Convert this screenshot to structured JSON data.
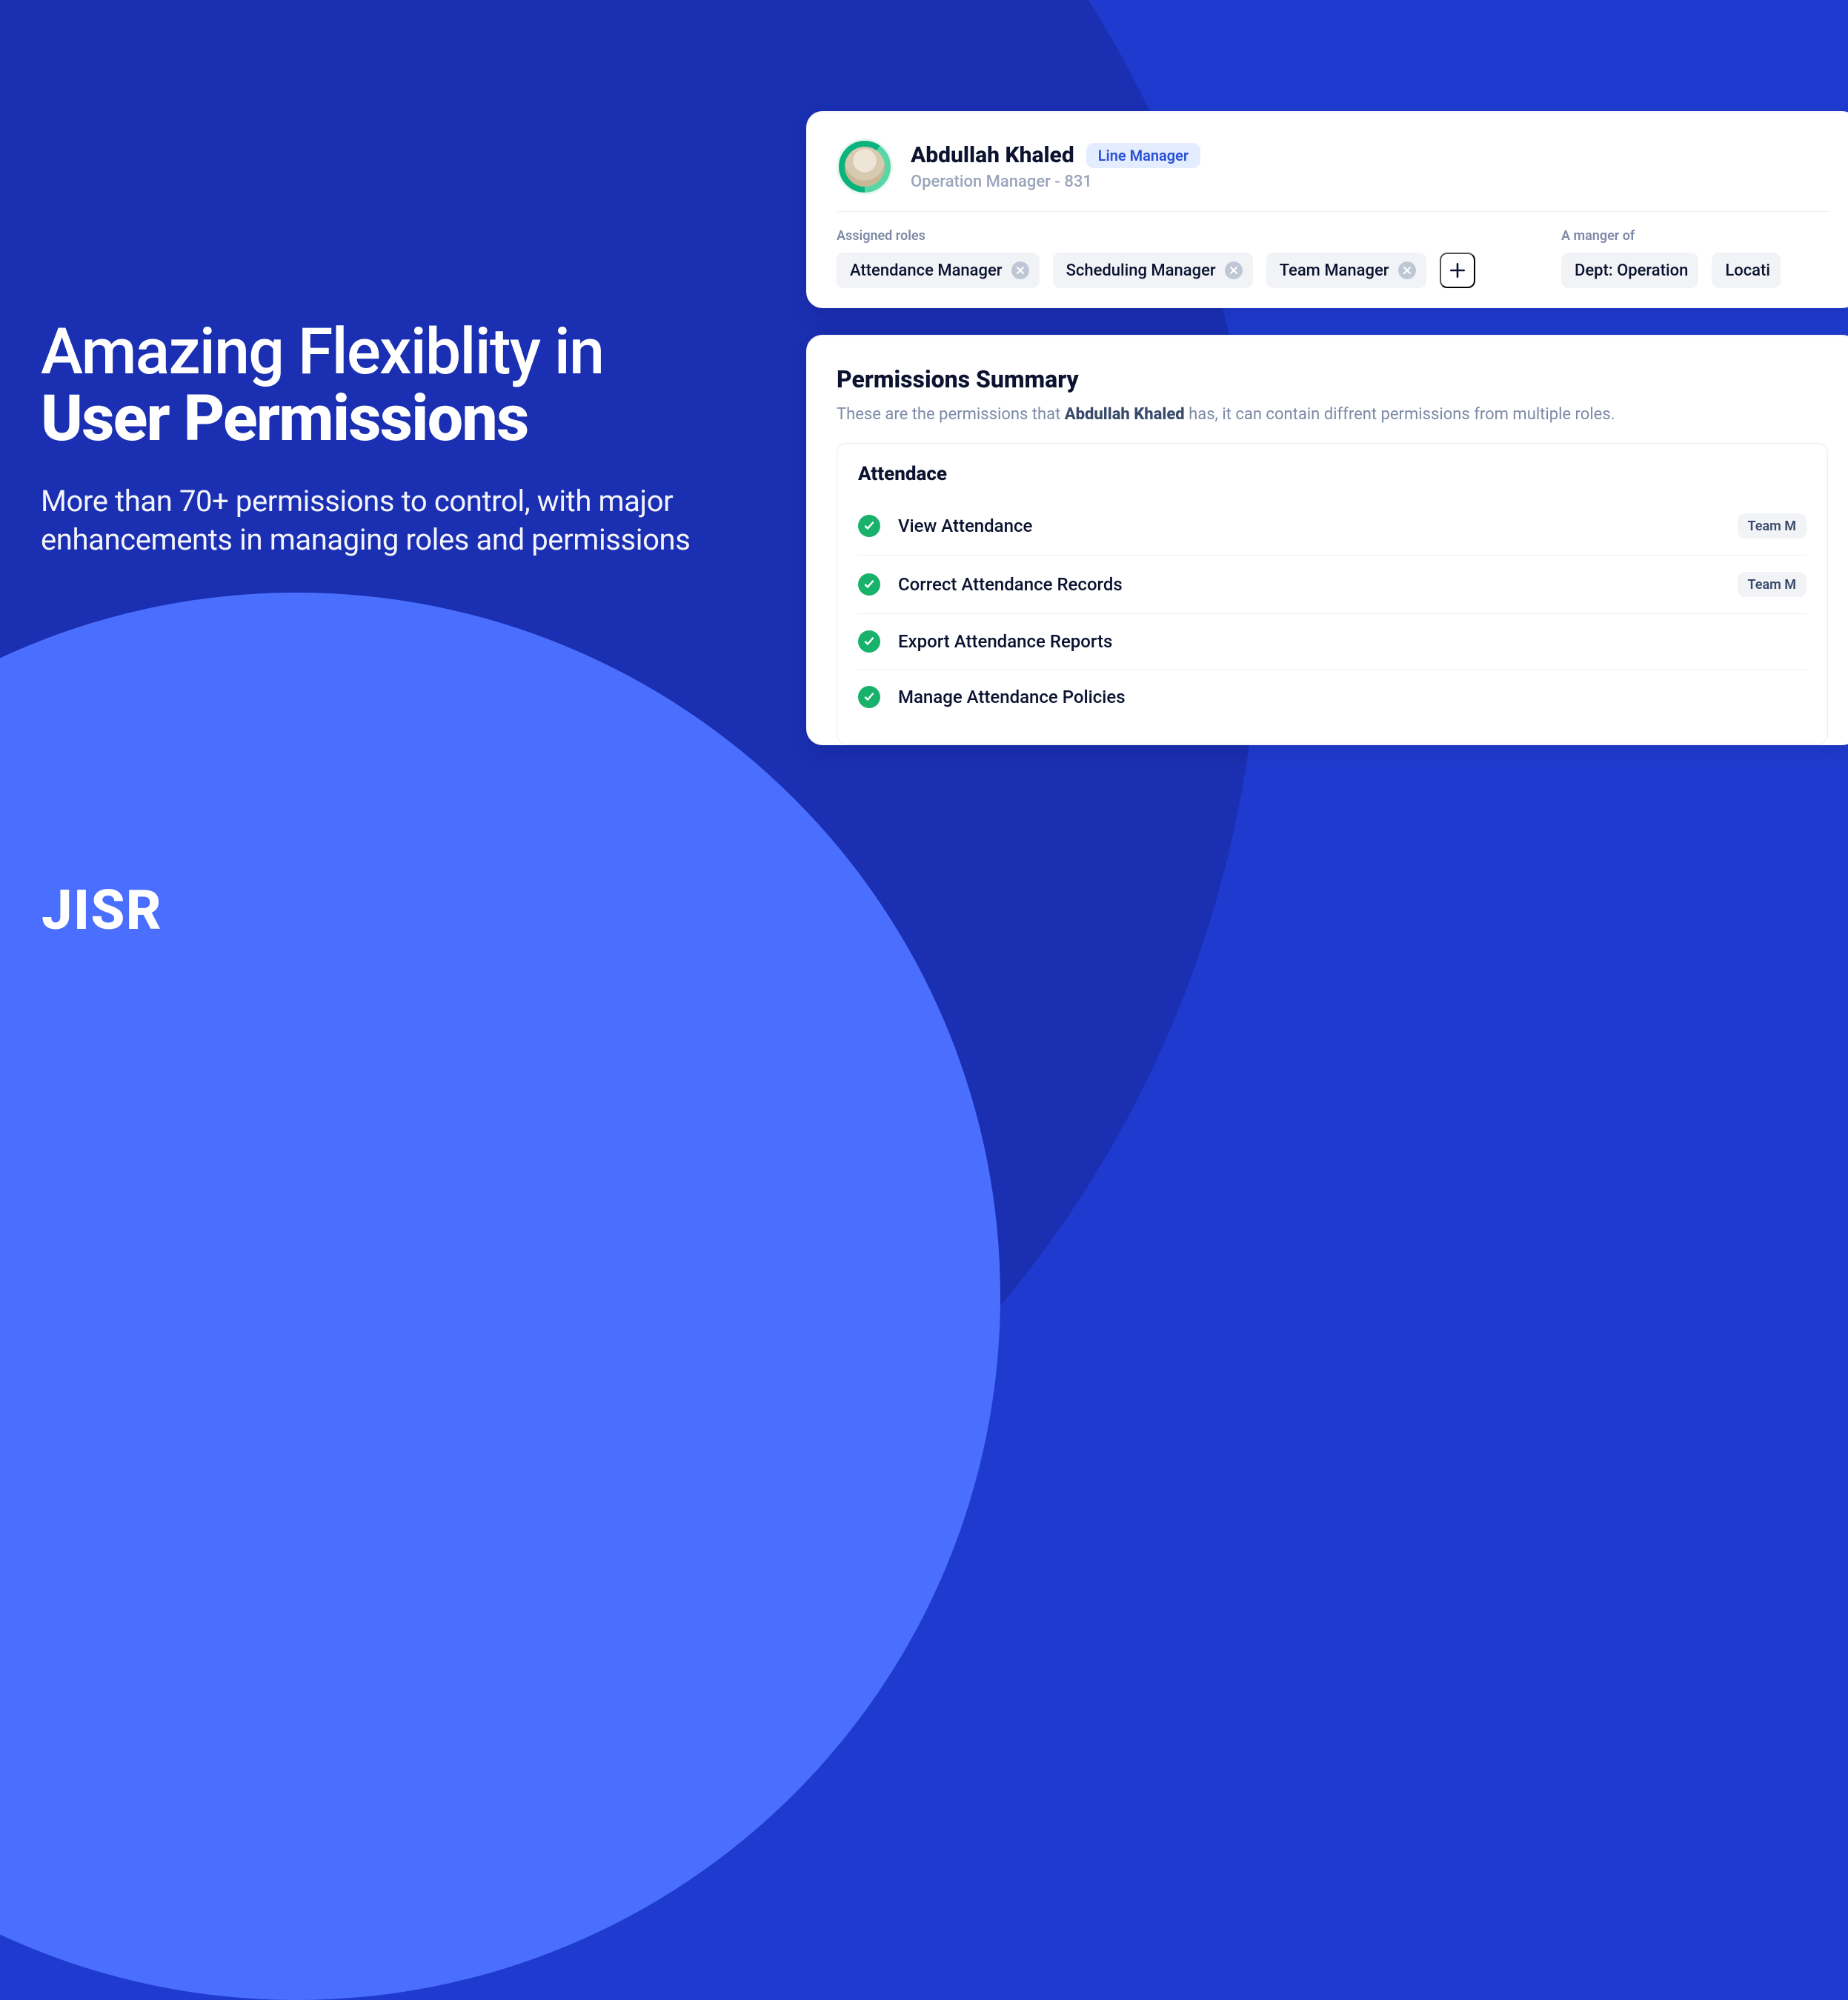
{
  "hero": {
    "title_line1": "Amazing Flexiblity in",
    "title_bold": "User Permissions",
    "subtitle": "More than 70+ permissions to control, with major enhancements in managing roles and permissions"
  },
  "brand": {
    "name": "JISR"
  },
  "user": {
    "name": "Abdullah Khaled",
    "badge": "Line Manager",
    "subtitle": "Operation Manager - 831"
  },
  "roles": {
    "label": "Assigned roles",
    "items": [
      {
        "label": "Attendance Manager"
      },
      {
        "label": "Scheduling Manager"
      },
      {
        "label": "Team Manager"
      }
    ]
  },
  "manager_of": {
    "label": "A manger of",
    "items": [
      {
        "label": "Dept: Operation"
      },
      {
        "label": "Locati"
      }
    ]
  },
  "permissions": {
    "title": "Permissions Summary",
    "desc_prefix": "These are the permissions that ",
    "desc_name": "Abdullah Khaled",
    "desc_suffix": " has, it can contain diffrent permissions from multiple roles.",
    "group_title": "Attendace",
    "items": [
      {
        "name": "View Attendance",
        "access": "Team M"
      },
      {
        "name": "Correct Attendance Records",
        "access": "Team M"
      },
      {
        "name": "Export Attendance Reports",
        "access": ""
      },
      {
        "name": "Manage Attendance Policies",
        "access": ""
      }
    ]
  }
}
